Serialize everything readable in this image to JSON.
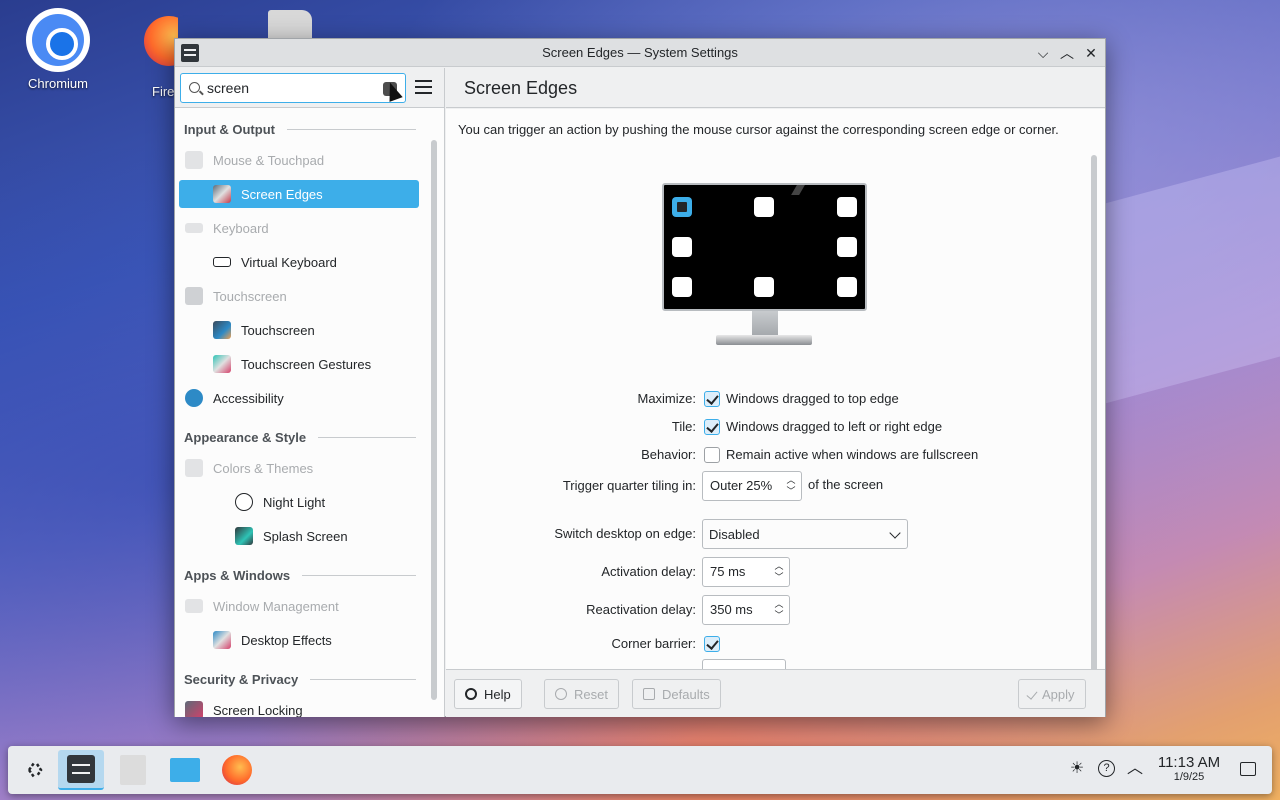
{
  "desktop": {
    "icons": [
      {
        "label": "Chromium"
      },
      {
        "label": "Fire"
      }
    ]
  },
  "window": {
    "title": "Screen Edges — System Settings",
    "controls": {
      "minimize": "⌵",
      "maximize": "︿",
      "close": "✕"
    }
  },
  "sidebar": {
    "search_value": "screen",
    "categories": [
      {
        "label": "Input & Output"
      },
      {
        "label": "Appearance & Style"
      },
      {
        "label": "Apps & Windows"
      },
      {
        "label": "Security & Privacy"
      }
    ],
    "items": [
      {
        "label": "Mouse & Touchpad",
        "state": "dim"
      },
      {
        "label": "Screen Edges",
        "state": "selected"
      },
      {
        "label": "Keyboard",
        "state": "dim"
      },
      {
        "label": "Virtual Keyboard",
        "state": "normal"
      },
      {
        "label": "Touchscreen",
        "state": "dim"
      },
      {
        "label": "Touchscreen",
        "state": "normal"
      },
      {
        "label": "Touchscreen Gestures",
        "state": "normal"
      },
      {
        "label": "Accessibility",
        "state": "normal"
      },
      {
        "label": "Colors & Themes",
        "state": "dim"
      },
      {
        "label": "Night Light",
        "state": "normal"
      },
      {
        "label": "Splash Screen",
        "state": "normal"
      },
      {
        "label": "Window Management",
        "state": "dim"
      },
      {
        "label": "Desktop Effects",
        "state": "normal"
      },
      {
        "label": "Screen Locking",
        "state": "normal"
      }
    ]
  },
  "main": {
    "title": "Screen Edges",
    "description": "You can trigger an action by pushing the mouse cursor against the corresponding screen edge or corner.",
    "form": {
      "maximize": {
        "label": "Maximize:",
        "text": "Windows dragged to top edge",
        "checked": true
      },
      "tile": {
        "label": "Tile:",
        "text": "Windows dragged to left or right edge",
        "checked": true
      },
      "behavior": {
        "label": "Behavior:",
        "text": "Remain active when windows are fullscreen",
        "checked": false
      },
      "quarter": {
        "label": "Trigger quarter tiling in:",
        "value": "Outer 25%",
        "suffix": "of the screen"
      },
      "switch_desktop": {
        "label": "Switch desktop on edge:",
        "value": "Disabled"
      },
      "activation": {
        "label": "Activation delay:",
        "value": "75 ms"
      },
      "reactivation": {
        "label": "Reactivation delay:",
        "value": "350 ms"
      },
      "corner_barrier": {
        "label": "Corner barrier:",
        "checked": true
      }
    },
    "footer": {
      "help": "Help",
      "reset": "Reset",
      "defaults": "Defaults",
      "apply": "Apply"
    }
  },
  "taskbar": {
    "time": "11:13 AM",
    "date": "1/9/25"
  },
  "colors": {
    "accent": "#3daee9",
    "window_bg": "#eff0f1",
    "text": "#232629"
  }
}
